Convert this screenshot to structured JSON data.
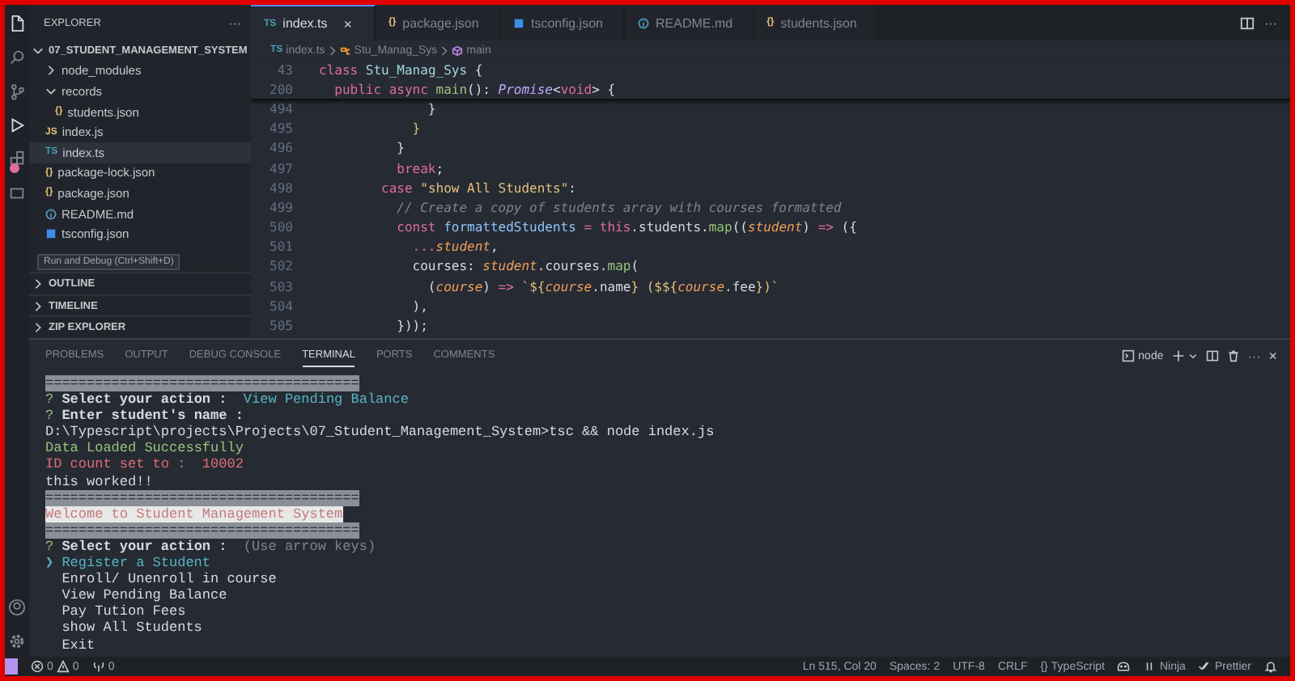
{
  "activity_bar": {
    "extensions_badge": true
  },
  "tooltip": {
    "text": "Run and Debug (Ctrl+Shift+D)"
  },
  "explorer": {
    "title": "EXPLORER",
    "more": "···",
    "root": {
      "label": "07_STUDENT_MANAGEMENT_SYSTEM",
      "expanded": true,
      "children": [
        {
          "label": "node_modules",
          "kind": "folder",
          "expanded": false,
          "selected": false
        },
        {
          "label": "records",
          "kind": "folder",
          "expanded": true,
          "selected": false,
          "children": [
            {
              "label": "students.json",
              "kind": "json",
              "badge": "{}",
              "selected": false
            }
          ]
        },
        {
          "label": "index.js",
          "kind": "js",
          "badge": "JS",
          "selected": false
        },
        {
          "label": "index.ts",
          "kind": "ts",
          "badge": "TS",
          "selected": true
        },
        {
          "label": "package-lock.json",
          "kind": "json",
          "badge": "{}",
          "selected": false
        },
        {
          "label": "package.json",
          "kind": "json",
          "badge": "{}",
          "selected": false
        },
        {
          "label": "README.md",
          "kind": "info",
          "selected": false
        },
        {
          "label": "tsconfig.json",
          "kind": "config",
          "selected": false
        }
      ]
    },
    "sections": [
      {
        "label": "OUTLINE",
        "expanded": false
      },
      {
        "label": "TIMELINE",
        "expanded": false
      },
      {
        "label": "ZIP EXPLORER",
        "expanded": false
      }
    ]
  },
  "editor_tabs": [
    {
      "label": "index.ts",
      "kind": "ts",
      "badge": "TS",
      "selected": true,
      "close": "×"
    },
    {
      "label": "package.json",
      "kind": "json",
      "badge": "{}",
      "selected": false
    },
    {
      "label": "tsconfig.json",
      "kind": "config",
      "selected": false
    },
    {
      "label": "README.md",
      "kind": "info",
      "selected": false
    },
    {
      "label": "students.json",
      "kind": "json",
      "badge": "{}",
      "selected": false
    }
  ],
  "editor_actions": {
    "more": "···"
  },
  "breadcrumbs": [
    {
      "label": "index.ts",
      "kind": "ts",
      "badge": "TS"
    },
    {
      "label": "Stu_Manag_Sys",
      "kind": "class"
    },
    {
      "label": "main",
      "kind": "method"
    }
  ],
  "sticky_lines": [
    {
      "number": "43",
      "tokens": [
        {
          "kind": "kw",
          "text": "class "
        },
        {
          "kind": "cls",
          "text": "Stu_Manag_Sys"
        },
        {
          "kind": "punc",
          "text": " {"
        }
      ]
    },
    {
      "number": "200",
      "tokens": [
        {
          "kind": "kw",
          "text": "  public async "
        },
        {
          "kind": "fn",
          "text": "main"
        },
        {
          "kind": "punc",
          "text": "(): "
        },
        {
          "kind": "type",
          "text": "Promise"
        },
        {
          "kind": "punc",
          "text": "<"
        },
        {
          "kind": "kw",
          "text": "void"
        },
        {
          "kind": "punc",
          "text": "> {"
        }
      ]
    }
  ],
  "code_lines": [
    {
      "number": "494",
      "tokens": [
        {
          "kind": "punc",
          "text": "              }"
        }
      ]
    },
    {
      "number": "495",
      "tokens": [
        {
          "kind": "brace",
          "text": "            }"
        }
      ]
    },
    {
      "number": "496",
      "tokens": [
        {
          "kind": "punc",
          "text": "          }"
        }
      ]
    },
    {
      "number": "497",
      "tokens": [
        {
          "kind": "kw",
          "text": "          break"
        },
        {
          "kind": "punc",
          "text": ";"
        }
      ]
    },
    {
      "number": "498",
      "tokens": [
        {
          "kind": "kw",
          "text": "        case "
        },
        {
          "kind": "str",
          "text": "\"show All Students\""
        },
        {
          "kind": "punc",
          "text": ":"
        }
      ]
    },
    {
      "number": "499",
      "tokens": [
        {
          "kind": "cmt",
          "text": "          // Create a copy of students array with courses formatted"
        }
      ]
    },
    {
      "number": "500",
      "tokens": [
        {
          "kind": "kw",
          "text": "          const "
        },
        {
          "kind": "var",
          "text": "formattedStudents"
        },
        {
          "kind": "op",
          "text": " = "
        },
        {
          "kind": "kw",
          "text": "this"
        },
        {
          "kind": "punc",
          "text": "."
        },
        {
          "kind": "prop",
          "text": "students"
        },
        {
          "kind": "punc",
          "text": "."
        },
        {
          "kind": "fn",
          "text": "map"
        },
        {
          "kind": "punc",
          "text": "(("
        },
        {
          "kind": "param",
          "text": "student"
        },
        {
          "kind": "punc",
          "text": ") "
        },
        {
          "kind": "op",
          "text": "=>"
        },
        {
          "kind": "punc",
          "text": " ({"
        }
      ]
    },
    {
      "number": "501",
      "tokens": [
        {
          "kind": "op",
          "text": "            ..."
        },
        {
          "kind": "param",
          "text": "student"
        },
        {
          "kind": "punc",
          "text": ","
        }
      ]
    },
    {
      "number": "502",
      "tokens": [
        {
          "kind": "prop",
          "text": "            courses"
        },
        {
          "kind": "punc",
          "text": ": "
        },
        {
          "kind": "param",
          "text": "student"
        },
        {
          "kind": "punc",
          "text": "."
        },
        {
          "kind": "prop",
          "text": "courses"
        },
        {
          "kind": "punc",
          "text": "."
        },
        {
          "kind": "fn",
          "text": "map"
        },
        {
          "kind": "punc",
          "text": "("
        }
      ]
    },
    {
      "number": "503",
      "tokens": [
        {
          "kind": "punc",
          "text": "              ("
        },
        {
          "kind": "param",
          "text": "course"
        },
        {
          "kind": "punc",
          "text": ") "
        },
        {
          "kind": "op",
          "text": "=>"
        },
        {
          "kind": "str",
          "text": " `${"
        },
        {
          "kind": "param",
          "text": "course"
        },
        {
          "kind": "punc",
          "text": "."
        },
        {
          "kind": "prop",
          "text": "name"
        },
        {
          "kind": "str",
          "text": "} ($${"
        },
        {
          "kind": "param",
          "text": "course"
        },
        {
          "kind": "punc",
          "text": "."
        },
        {
          "kind": "prop",
          "text": "fee"
        },
        {
          "kind": "str",
          "text": "})`"
        }
      ]
    },
    {
      "number": "504",
      "tokens": [
        {
          "kind": "punc",
          "text": "            ),"
        }
      ]
    },
    {
      "number": "505",
      "tokens": [
        {
          "kind": "punc",
          "text": "          }));"
        }
      ]
    }
  ],
  "panel": {
    "tabs": [
      {
        "label": "PROBLEMS",
        "selected": false
      },
      {
        "label": "OUTPUT",
        "selected": false
      },
      {
        "label": "DEBUG CONSOLE",
        "selected": false
      },
      {
        "label": "TERMINAL",
        "selected": true
      },
      {
        "label": "PORTS",
        "selected": false
      },
      {
        "label": "COMMENTS",
        "selected": false
      }
    ],
    "terminal_name": "node",
    "more": "···",
    "close": "×"
  },
  "terminal": {
    "lines": [
      [
        {
          "kind": "banner",
          "text": "======================================"
        }
      ],
      [
        {
          "kind": "prompt",
          "text": "? "
        },
        {
          "kind": "bold",
          "text": "Select your action :"
        },
        {
          "kind": "answer",
          "text": "  View Pending Balance"
        }
      ],
      [
        {
          "kind": "prompt",
          "text": "? "
        },
        {
          "kind": "bold",
          "text": "Enter student's name :"
        }
      ],
      [
        {
          "kind": "plain",
          "text": "D:\\Typescript\\projects\\Projects\\07_Student_Management_System>tsc && node index.js"
        }
      ],
      [
        {
          "kind": "success",
          "text": "Data Loaded Successfully"
        }
      ],
      [
        {
          "kind": "error",
          "text": "ID count set to :  10002"
        }
      ],
      [
        {
          "kind": "plain",
          "text": "this worked!!"
        }
      ],
      [
        {
          "kind": "banner",
          "text": "======================================"
        }
      ],
      [
        {
          "kind": "inverse",
          "text": "Welcome to Student Management System"
        }
      ],
      [
        {
          "kind": "banner",
          "text": "======================================"
        }
      ],
      [
        {
          "kind": "prompt",
          "text": "? "
        },
        {
          "kind": "bold",
          "text": "Select your action :"
        },
        {
          "kind": "hint",
          "text": "  (Use arrow keys)"
        }
      ]
    ],
    "menu": {
      "pointer": "❯",
      "options": [
        {
          "label": "Register a Student",
          "selected": true
        },
        {
          "label": "Enroll/ Unenroll in course",
          "selected": false
        },
        {
          "label": "View Pending Balance",
          "selected": false
        },
        {
          "label": "Pay Tution Fees",
          "selected": false
        },
        {
          "label": "show All Students",
          "selected": false
        },
        {
          "label": "Exit",
          "selected": false
        }
      ]
    }
  },
  "status_bar": {
    "errors": "0",
    "warnings": "0",
    "ports": "0",
    "right": [
      {
        "kind": "text",
        "label": "Ln 515, Col 20"
      },
      {
        "kind": "text",
        "label": "Spaces: 2"
      },
      {
        "kind": "text",
        "label": "UTF-8"
      },
      {
        "kind": "text",
        "label": "CRLF"
      },
      {
        "kind": "language",
        "label": "TypeScript",
        "glyph": "{}"
      },
      {
        "kind": "copilot"
      },
      {
        "kind": "ninja",
        "label": "Ninja"
      },
      {
        "kind": "prettier",
        "label": "Prettier"
      },
      {
        "kind": "bell"
      }
    ]
  }
}
